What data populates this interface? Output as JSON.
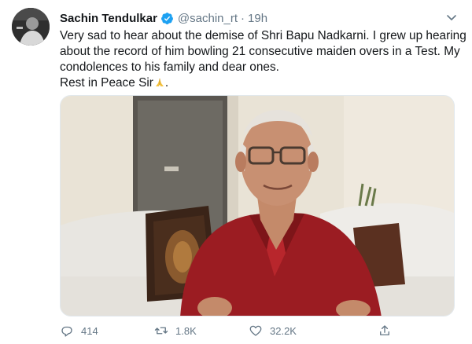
{
  "tweet": {
    "author_name": "Sachin Tendulkar",
    "handle": "@sachin_rt",
    "separator": "·",
    "time": "19h",
    "text_lines": [
      "Very sad to hear about the demise of Shri Bapu Nadkarni. I grew up hearing",
      "about the record of him bowling 21 consecutive maiden overs in a Test. My",
      "condolences to his family and dear ones.",
      "Rest in Peace Sir"
    ],
    "text_suffix": "."
  },
  "actions": {
    "reply_count": "414",
    "retweet_count": "1.8K",
    "like_count": "32.2K"
  },
  "icons": {
    "verified": "verified-badge-icon",
    "caret": "chevron-down-icon",
    "reply": "reply-icon",
    "retweet": "retweet-icon",
    "like": "heart-icon",
    "share": "share-icon",
    "emoji": "folded-hands-emoji"
  },
  "colors": {
    "verified_blue": "#1da1f2",
    "secondary_text": "#657786",
    "primary_text": "#14171a"
  }
}
